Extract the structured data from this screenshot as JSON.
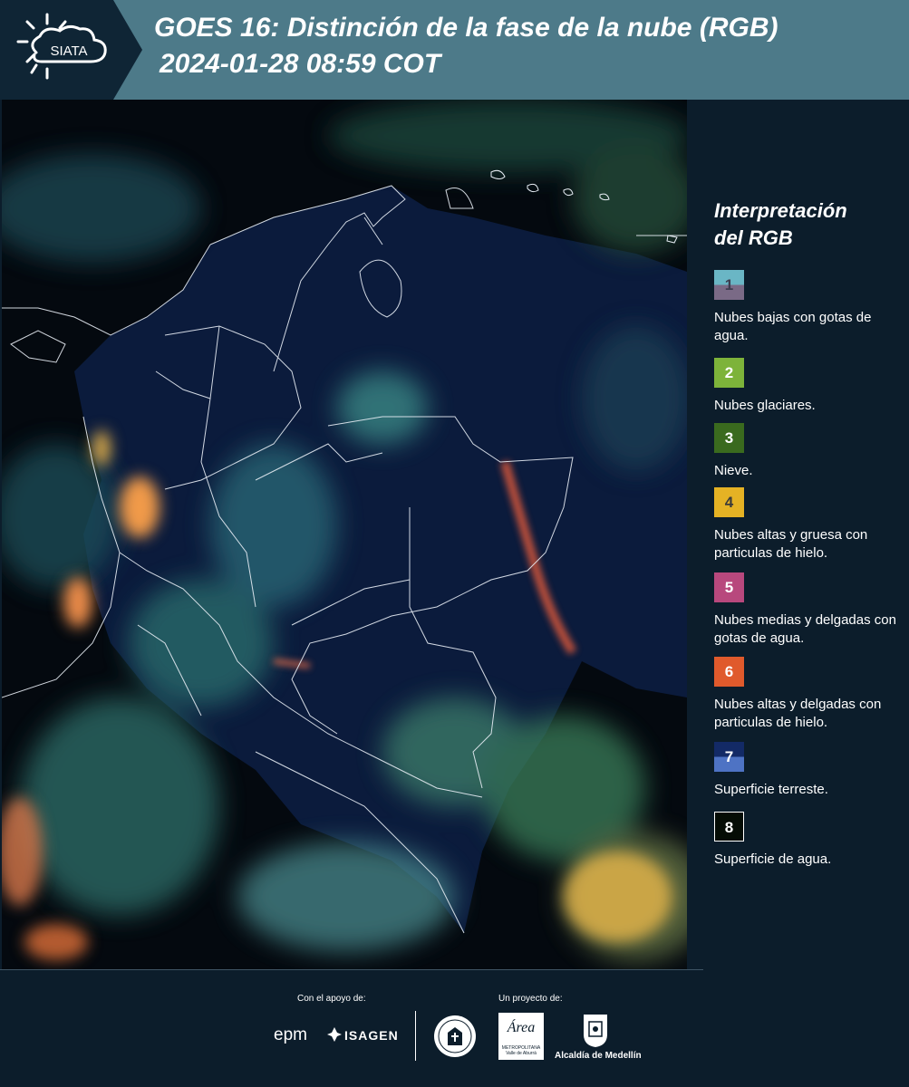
{
  "header": {
    "logo_text": "SIATA",
    "title_line1": "GOES 16: Distinción de la fase de la nube (RGB)",
    "title_line2": "2024-01-28 08:59 COT"
  },
  "legend": {
    "title_line1": "Interpretación",
    "title_line2": "del RGB",
    "items": [
      {
        "number": "1",
        "label": "Nubes bajas con gotas de agua.",
        "color_top": "#6ab6c5",
        "color_bottom": "#7a6a86"
      },
      {
        "number": "2",
        "label": "Nubes glaciares.",
        "color": "#7db33a"
      },
      {
        "number": "3",
        "label": "Nieve.",
        "color": "#3a6a1e"
      },
      {
        "number": "4",
        "label": "Nubes altas y gruesa con particulas de hielo.",
        "color": "#e5b224"
      },
      {
        "number": "5",
        "label": "Nubes medias y delgadas con gotas de agua.",
        "color": "#b8487d"
      },
      {
        "number": "6",
        "label": "Nubes altas y delgadas con particulas de hielo.",
        "color": "#e05a2c"
      },
      {
        "number": "7",
        "label": "Superficie terreste.",
        "color_top": "#132a66",
        "color_bottom": "#4e73c4"
      },
      {
        "number": "8",
        "label": "Superficie de agua.",
        "color": "#050c05"
      }
    ]
  },
  "footer": {
    "support_label": "Con el apoyo de:",
    "project_label": "Un proyecto de:",
    "epm_text": "epm",
    "isagen_text": "ISAGEN",
    "area_text": "Área",
    "area_subtitle": "METROPOLITANA",
    "area_subtitle2": "Valle de Aburrá",
    "alcaldia_text": "Alcaldía de Medellín"
  }
}
